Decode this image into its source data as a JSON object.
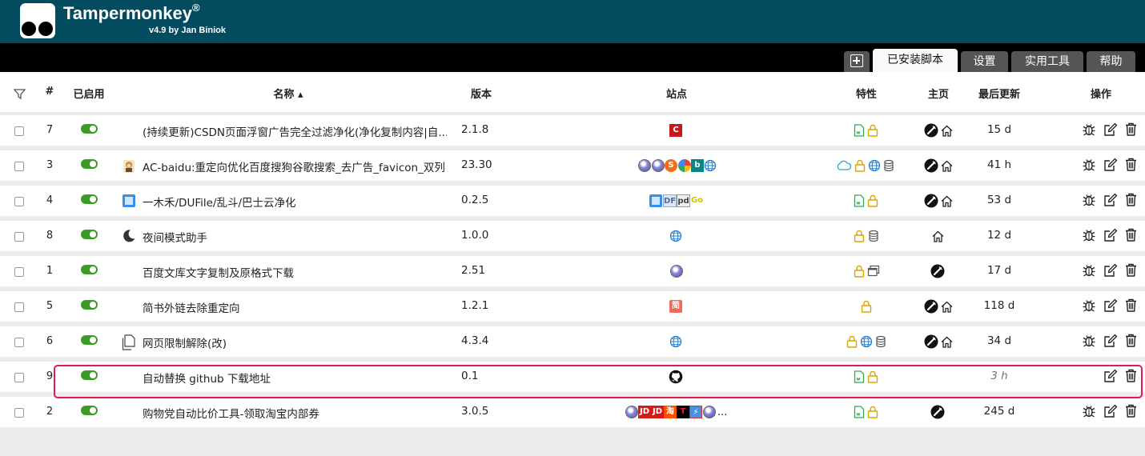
{
  "app": {
    "title": "Tampermonkey",
    "registered": "®",
    "version": "v4.9 by Jan Biniok"
  },
  "tabs": [
    {
      "label": "",
      "icon": "add-script-icon"
    },
    {
      "label": "已安装脚本",
      "active": true
    },
    {
      "label": "设置"
    },
    {
      "label": "实用工具"
    },
    {
      "label": "帮助"
    }
  ],
  "columns": {
    "filter": "filter-icon",
    "num": "#",
    "enabled": "已启用",
    "name": "名称 ▴",
    "version": "版本",
    "sites": "站点",
    "features": "特性",
    "homepage": "主页",
    "updated": "最后更新",
    "actions": "操作"
  },
  "scripts": [
    {
      "num": "7",
      "enabled": true,
      "name": "(持续更新)CSDN页面浮窗广告完全过滤净化(净化复制内容|自...",
      "version": "2.1.8",
      "updated": "15 d",
      "sites": [
        "csdn"
      ],
      "features": [
        "userscript-file",
        "lock"
      ],
      "homepage": [
        "site-icon",
        "home"
      ]
    },
    {
      "num": "3",
      "enabled": true,
      "name": "AC-baidu:重定向优化百度搜狗谷歌搜索_去广告_favicon_双列",
      "version": "23.30",
      "updated": "41 h",
      "sites": [
        "globe-purple",
        "globe-purple",
        "sogou",
        "google",
        "bing",
        "globe"
      ],
      "features": [
        "cloud",
        "lock",
        "globe",
        "database"
      ],
      "homepage": [
        "site-icon",
        "home"
      ]
    },
    {
      "num": "4",
      "enabled": true,
      "name": "一木禾/DUFile/乱斗/巴士云净化",
      "version": "0.2.5",
      "updated": "53 d",
      "sites": [
        "blue-doc",
        "DF",
        "pd",
        "go"
      ],
      "features": [
        "userscript-file",
        "lock"
      ],
      "homepage": [
        "site-icon",
        "home"
      ]
    },
    {
      "num": "8",
      "enabled": true,
      "name": "夜间模式助手",
      "version": "1.0.0",
      "updated": "12 d",
      "sites": [
        "globe"
      ],
      "features": [
        "lock",
        "database"
      ],
      "homepage": [
        "home"
      ]
    },
    {
      "num": "1",
      "enabled": true,
      "name": "百度文库文字复制及原格式下载",
      "version": "2.51",
      "updated": "17 d",
      "sites": [
        "globe-purple"
      ],
      "features": [
        "lock",
        "window"
      ],
      "homepage": [
        "site-icon"
      ]
    },
    {
      "num": "5",
      "enabled": true,
      "name": "简书外链去除重定向",
      "version": "1.2.1",
      "updated": "118 d",
      "sites": [
        "jianshu"
      ],
      "features": [
        "lock"
      ],
      "homepage": [
        "site-icon",
        "home"
      ]
    },
    {
      "num": "6",
      "enabled": true,
      "name": "网页限制解除(改)",
      "version": "4.3.4",
      "updated": "34 d",
      "sites": [
        "globe"
      ],
      "features": [
        "lock",
        "globe",
        "database"
      ],
      "homepage": [
        "site-icon",
        "home"
      ]
    },
    {
      "num": "9",
      "enabled": true,
      "name": "自动替换 github 下载地址",
      "version": "0.1",
      "updated": "3 h",
      "sites": [
        "github"
      ],
      "features": [
        "userscript-file",
        "lock"
      ],
      "homepage": [],
      "highlighted": true
    },
    {
      "num": "2",
      "enabled": true,
      "name": "购物党自动比价工具-领取淘宝内部券",
      "version": "3.0.5",
      "updated": "245 d",
      "sites": [
        "globe-purple",
        "JD",
        "JD",
        "淘",
        "T",
        "tmall",
        "globe-purple",
        "..."
      ],
      "features": [
        "userscript-file",
        "lock"
      ],
      "homepage": [
        "site-icon"
      ]
    }
  ],
  "site_text": {
    "csdn": "C",
    "jianshu": "简",
    "df": "DF",
    "pd": "pd",
    "go": "Go",
    "jd": "JD",
    "tao": "淘",
    "t": "T",
    "more": "..."
  },
  "colors": {
    "header": "#034b5f",
    "toggle_on": "#3c9a26",
    "feature_gold": "#d9a300",
    "feature_green": "#2eaa5c",
    "highlight": "#e01a4f"
  }
}
